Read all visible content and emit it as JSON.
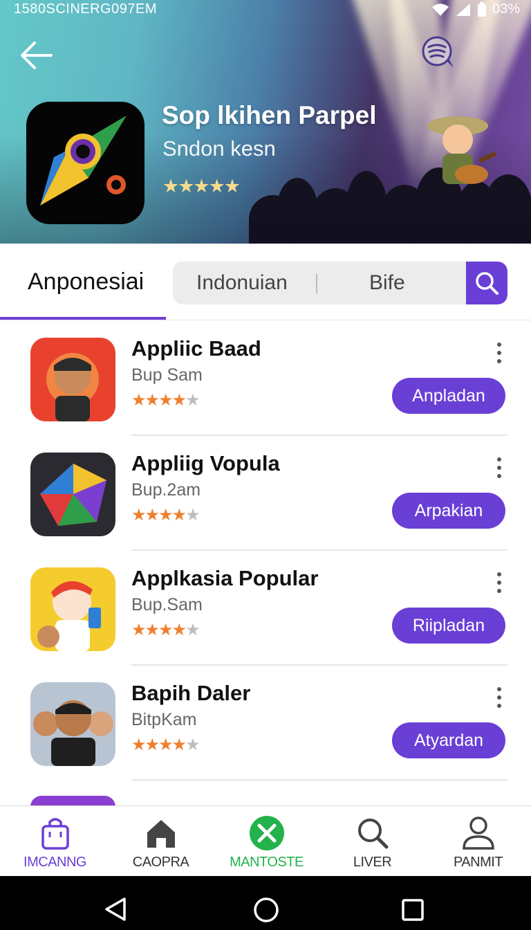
{
  "status_bar": {
    "left_text": "1580SCINERG097EM",
    "battery": "03%"
  },
  "header": {
    "app_title": "Sop lkihen Parpel",
    "app_subtitle": "Sndon kesn",
    "app_rating_stars": "★★★★★"
  },
  "tabs": {
    "active_label": "Anponesiai"
  },
  "segment": {
    "option_a": "Indonuian",
    "option_b": "Bife"
  },
  "apps": [
    {
      "title": "Appliic Baad",
      "subtitle": "Bup Sam",
      "rating": 3.5,
      "button": "Anpladan"
    },
    {
      "title": "Appliig Vopula",
      "subtitle": "Bup.2am",
      "rating": 3.5,
      "button": "Arpakian"
    },
    {
      "title": "Applkasia Popular",
      "subtitle": "Bup.Sam",
      "rating": 4,
      "button": "Riipladan"
    },
    {
      "title": "Bapih Daler",
      "subtitle": "BitpΚam",
      "rating": 4,
      "button": "Atyardan"
    }
  ],
  "bottom_nav": [
    {
      "label": "IMCANNG",
      "icon": "bag-icon",
      "color": "#6a3fd6"
    },
    {
      "label": "CAOPRA",
      "icon": "home-icon",
      "color": "#444444"
    },
    {
      "label": "MANTOSTE",
      "icon": "close-circle-icon",
      "color": "#23b24b"
    },
    {
      "label": "LIVER",
      "icon": "search-icon",
      "color": "#444444"
    },
    {
      "label": "PANMIT",
      "icon": "person-icon",
      "color": "#444444"
    }
  ],
  "colors": {
    "accent": "#6a3fd6",
    "star": "#ef7f2d",
    "star_off": "#bdbdbd"
  }
}
